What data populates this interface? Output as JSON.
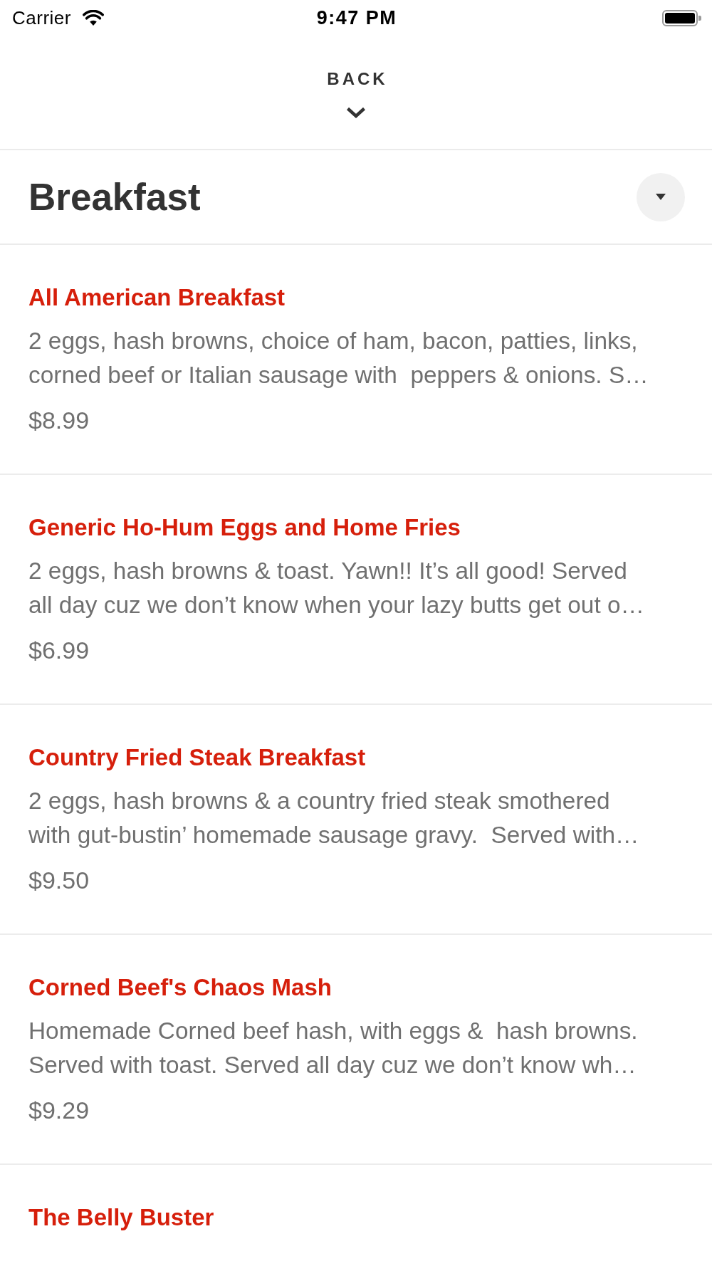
{
  "status_bar": {
    "carrier": "Carrier",
    "time": "9:47 PM"
  },
  "header": {
    "back_label": "BACK"
  },
  "section": {
    "title": "Breakfast"
  },
  "items": [
    {
      "name": "All American Breakfast",
      "description": "2 eggs, hash browns, choice of ham, bacon, patties, links, corned beef or Italian sausage with  peppers & onions. S…",
      "price": "$8.99"
    },
    {
      "name": "Generic Ho-Hum Eggs and Home Fries",
      "description": "2 eggs, hash browns & toast. Yawn!! It’s all good! Served all day cuz we don’t know when your lazy butts get out o…",
      "price": "$6.99"
    },
    {
      "name": "Country Fried Steak Breakfast",
      "description": "2 eggs, hash browns & a country fried steak smothered with gut-bustin’ homemade sausage gravy.  Served with…",
      "price": "$9.50"
    },
    {
      "name": "Corned Beef's Chaos Mash",
      "description": "Homemade Corned beef hash, with eggs &  hash browns. Served with toast. Served all day cuz we don’t know wh…",
      "price": "$9.29"
    },
    {
      "name": "The Belly Buster"
    }
  ]
}
